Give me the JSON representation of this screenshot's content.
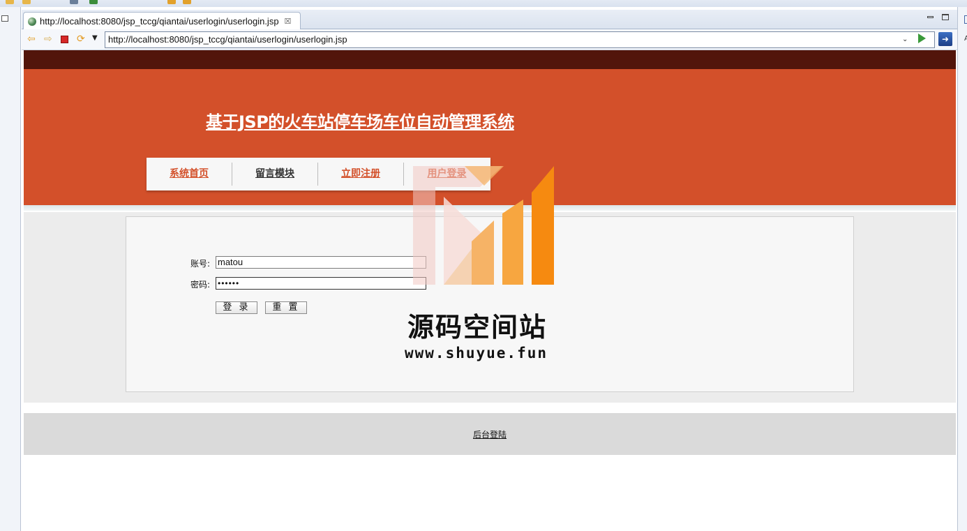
{
  "browser": {
    "tab_title": "http://localhost:8080/jsp_tccg/qiantai/userlogin/userlogin.jsp",
    "tab_close_icon": "close-icon",
    "url": "http://localhost:8080/jsp_tccg/qiantai/userlogin/userlogin.jsp",
    "right_edge_glyph": "A"
  },
  "site": {
    "title": "基于JSP的火车站停车场车位自动管理系统",
    "nav": [
      {
        "label": "系统首页"
      },
      {
        "label": "留言模块"
      },
      {
        "label": "立即注册"
      },
      {
        "label": "用户登录"
      }
    ]
  },
  "login": {
    "account_label": "账号:",
    "account_value": "matou",
    "password_label": "密码:",
    "password_value": "••••••",
    "login_button": "登 录",
    "reset_button": "重 置"
  },
  "footer": {
    "admin_link": "后台登陆"
  },
  "watermark": {
    "name": "源码空间站",
    "url": "www.shuyue.fun"
  },
  "colors": {
    "header_dark": "#52150b",
    "header_orange": "#d3502a",
    "nav_accent": "#d3502a"
  }
}
